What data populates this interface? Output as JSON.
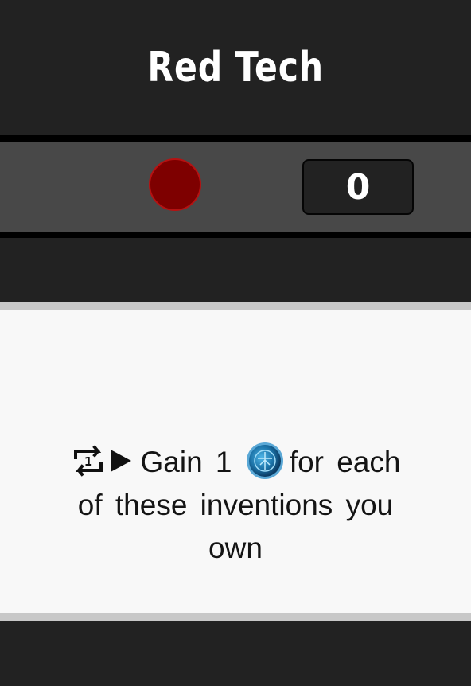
{
  "header": {
    "title": "Red Tech"
  },
  "counter": {
    "color_name": "red",
    "color": "#7e0000",
    "value": "0"
  },
  "card": {
    "icons": [
      "repeat-once-icon",
      "play-icon",
      "tech-token-icon"
    ],
    "text_gain": "Gain 1",
    "text_rest_1": "for each",
    "text_rest_2": "of these inventions you",
    "text_rest_3": "own"
  }
}
